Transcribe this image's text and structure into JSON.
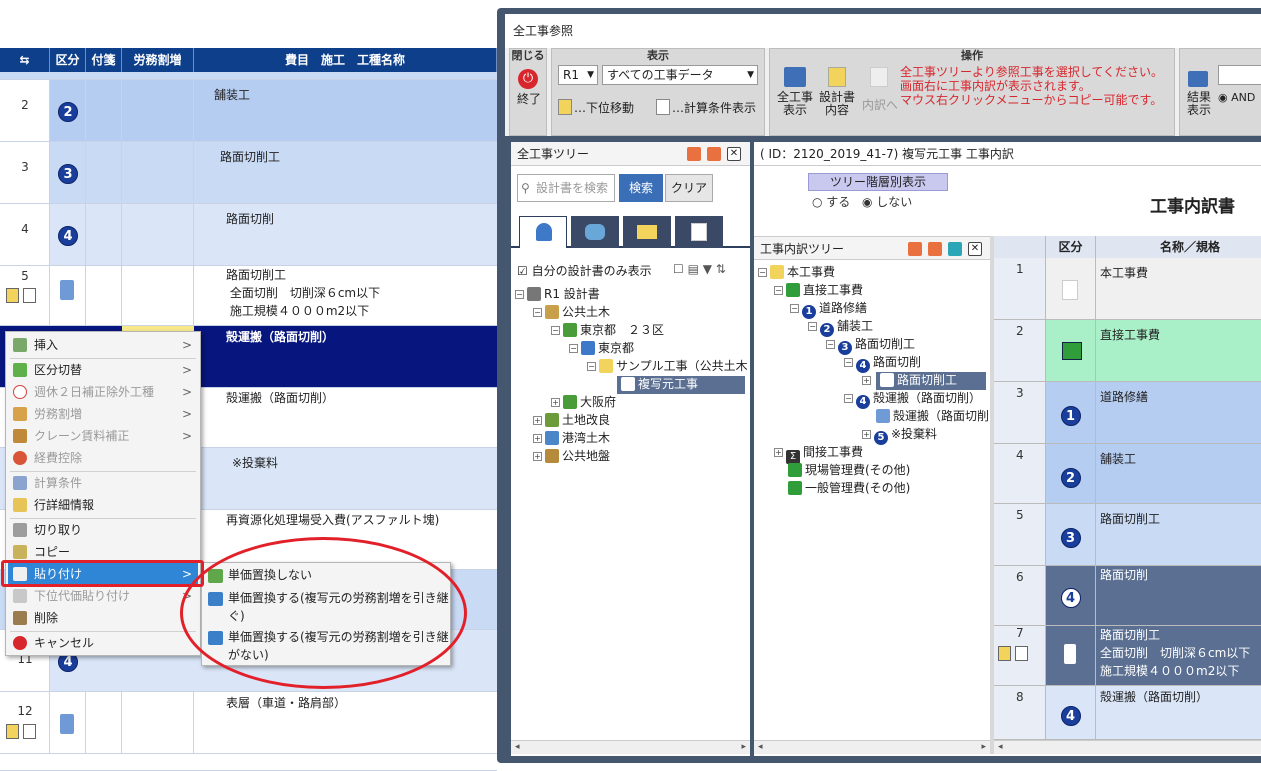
{
  "background_grid": {
    "headers": [
      "区分",
      "付箋",
      "労務割増",
      "費目　施工　工種名称"
    ],
    "rows": [
      {
        "num": "2",
        "kubun": "2",
        "name": "舗装工"
      },
      {
        "num": "3",
        "kubun": "3",
        "name": "路面切削工"
      },
      {
        "num": "4",
        "kubun": "4",
        "name": "路面切削"
      },
      {
        "num": "5",
        "name": "路面切削工\n 全面切削　切削深６cm以下\n 施工規模４０００m2以下"
      },
      {
        "num": "",
        "name": "殻運搬（路面切削）"
      },
      {
        "num": "",
        "name": "殻運搬（路面切削）"
      },
      {
        "num": "",
        "name": "※投棄料"
      },
      {
        "num": "",
        "name": "再資源化処理場受入費(アスファルト塊)"
      },
      {
        "num": "",
        "name": ""
      },
      {
        "num": "11",
        "kubun": "4",
        "name": ""
      },
      {
        "num": "12",
        "name": "表層（車道・路肩部）"
      }
    ]
  },
  "context_menu": {
    "items": [
      {
        "label": "挿入",
        "arrow": ">",
        "enabled": true
      },
      {
        "label": "区分切替",
        "arrow": ">",
        "enabled": true
      },
      {
        "label": "週休２日補正除外工種",
        "arrow": ">",
        "enabled": false
      },
      {
        "label": "労務割増",
        "arrow": ">",
        "enabled": false
      },
      {
        "label": "クレーン賃料補正",
        "arrow": ">",
        "enabled": false
      },
      {
        "label": "経費控除",
        "arrow": "",
        "enabled": false
      },
      {
        "label": "計算条件",
        "arrow": "",
        "enabled": false
      },
      {
        "label": "行詳細情報",
        "arrow": "",
        "enabled": true
      },
      {
        "label": "切り取り",
        "arrow": "",
        "enabled": true
      },
      {
        "label": "コピー",
        "arrow": "",
        "enabled": true
      },
      {
        "label": "貼り付け",
        "arrow": ">",
        "enabled": true
      },
      {
        "label": "下位代価貼り付け",
        "arrow": ">",
        "enabled": false
      },
      {
        "label": "削除",
        "arrow": "",
        "enabled": true
      },
      {
        "label": "キャンセル",
        "arrow": "",
        "enabled": true
      }
    ],
    "submenu": [
      "単価置換しない",
      "単価置換する(複写元の労務割増を引き継ぐ)",
      "単価置換する(複写元の労務割増を引き継がない)"
    ]
  },
  "dialog": {
    "title": "全工事参照",
    "toolbar": {
      "close_group_label": "閉じる",
      "close_button": "終了",
      "view_group_label": "表示",
      "select_r": "R1",
      "select_data": "すべての工事データ",
      "move_down": "…下位移動",
      "calc_display": "…計算条件表示",
      "op_group_label": "操作",
      "btn_all_display": "全工事\n表示",
      "btn_design": "設計書\n内容",
      "btn_inner": "内訳へ",
      "message": "全工事ツリーより参照工事を選択してください。\n画面右に工事内訳が表示されます。\nマウス右クリックメニューからコピー可能です。",
      "result_display": "結果\n表示",
      "and_label": "AND"
    },
    "left_pane": {
      "title": "全工事ツリー",
      "search_placeholder": "設計書を検索",
      "search_button": "検索",
      "clear_button": "クリア",
      "only_mine": "自分の設計書のみ表示",
      "tree": [
        {
          "label": "R1 設計書",
          "depth": 0
        },
        {
          "label": "公共土木",
          "depth": 1
        },
        {
          "label": "東京都　２３区",
          "depth": 2
        },
        {
          "label": "東京都",
          "depth": 3
        },
        {
          "label": "サンプル工事（公共土木",
          "depth": 4
        },
        {
          "label": "複写元工事",
          "depth": 5
        },
        {
          "label": "大阪府",
          "depth": 2
        },
        {
          "label": "土地改良",
          "depth": 1
        },
        {
          "label": "港湾土木",
          "depth": 1
        },
        {
          "label": "公共地盤",
          "depth": 1
        }
      ]
    },
    "right_pane": {
      "header": "( ID：2120_2019_41-7)  複写元工事 工事内訳",
      "tree_toggle_button": "ツリー階層別表示",
      "radio_yes": "する",
      "radio_no": "しない",
      "doc_title": "工事内訳書",
      "tree_title": "工事内訳ツリー",
      "tree": [
        {
          "label": "本工事費",
          "depth": 0
        },
        {
          "label": "直接工事費",
          "depth": 1
        },
        {
          "label": "道路修繕",
          "depth": 2,
          "k": "1"
        },
        {
          "label": "舗装工",
          "depth": 3,
          "k": "2"
        },
        {
          "label": "路面切削工",
          "depth": 4,
          "k": "3"
        },
        {
          "label": "路面切削",
          "depth": 5,
          "k": "4"
        },
        {
          "label": "路面切削工",
          "depth": 6
        },
        {
          "label": "殻運搬（路面切削）",
          "depth": 5,
          "k": "4"
        },
        {
          "label": "殻運搬（路面切削",
          "depth": 6
        },
        {
          "label": "※投棄料",
          "depth": 6,
          "k": "5"
        },
        {
          "label": "間接工事費",
          "depth": 1
        },
        {
          "label": "現場管理費(その他)",
          "depth": 1
        },
        {
          "label": "一般管理費(その他)",
          "depth": 1
        }
      ],
      "table_headers": [
        "区分",
        "名称／規格"
      ],
      "table_rows": [
        {
          "num": "1",
          "name": "本工事費"
        },
        {
          "num": "2",
          "name": "直接工事費"
        },
        {
          "num": "3",
          "k": "1",
          "name": "道路修繕"
        },
        {
          "num": "4",
          "k": "2",
          "name": "舗装工"
        },
        {
          "num": "5",
          "k": "3",
          "name": "路面切削工"
        },
        {
          "num": "6",
          "k": "4",
          "name": "路面切削"
        },
        {
          "num": "7",
          "name": "路面切削工\n全面切削　切削深６cm以下\n施工規模４０００m2以下"
        },
        {
          "num": "8",
          "k": "4",
          "name": "殻運搬（路面切削）"
        }
      ]
    }
  },
  "colors": {
    "header_blue": "#0e3f8a",
    "selected_row": "#07157e",
    "menu_highlight": "#2f86d6",
    "annotation_red": "#e2202a",
    "dialog_frame": "#45566f"
  }
}
